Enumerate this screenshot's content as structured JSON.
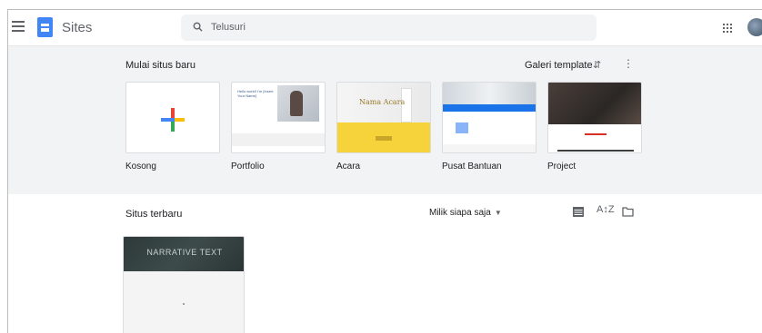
{
  "header": {
    "app_name": "Sites",
    "search_placeholder": "Telusuri"
  },
  "templates": {
    "heading": "Mulai situs baru",
    "gallery_label": "Galeri template",
    "items": [
      {
        "label": "Kosong"
      },
      {
        "label": "Portfolio",
        "thumb_text": "Hello world! I'm [Insert Your Name]"
      },
      {
        "label": "Acara",
        "thumb_text": "Nama Acara"
      },
      {
        "label": "Pusat Bantuan"
      },
      {
        "label": "Project"
      }
    ]
  },
  "recent": {
    "heading": "Situs terbaru",
    "owner_filter": "Milik siapa saja",
    "sites": [
      {
        "title": "NARRATIVE TEXT"
      }
    ]
  },
  "colors": {
    "accent": "#4285f4",
    "templates_bg": "#f1f3f4",
    "acara_yellow": "#f6d23b",
    "pusat_blue": "#1a73e8"
  }
}
